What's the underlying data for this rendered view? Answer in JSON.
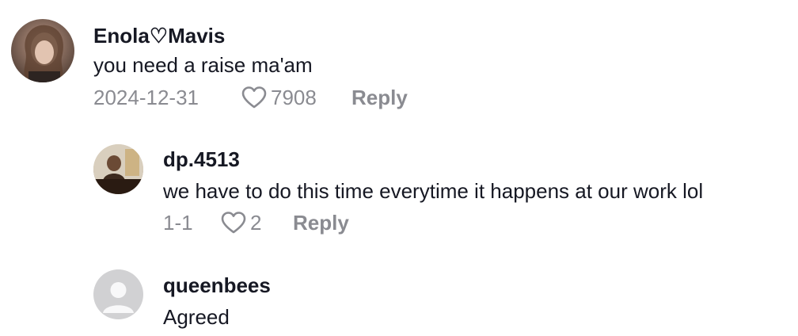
{
  "comments": [
    {
      "username": "Enola♡Mavis",
      "text": "you need a raise ma'am",
      "date": "2024-12-31",
      "likes": "7908",
      "reply_label": "Reply"
    },
    {
      "username": "dp.4513",
      "text": "we have to do this time everytime it happens at our work lol",
      "date": "1-1",
      "likes": "2",
      "reply_label": "Reply"
    },
    {
      "username": "queenbees",
      "text": "Agreed"
    }
  ],
  "colors": {
    "text_primary": "#161823",
    "text_secondary": "#8a8b91",
    "default_avatar_bg": "#d1d1d3"
  },
  "icons": {
    "like": "heart-outline-icon",
    "default_avatar": "person-silhouette-icon"
  }
}
